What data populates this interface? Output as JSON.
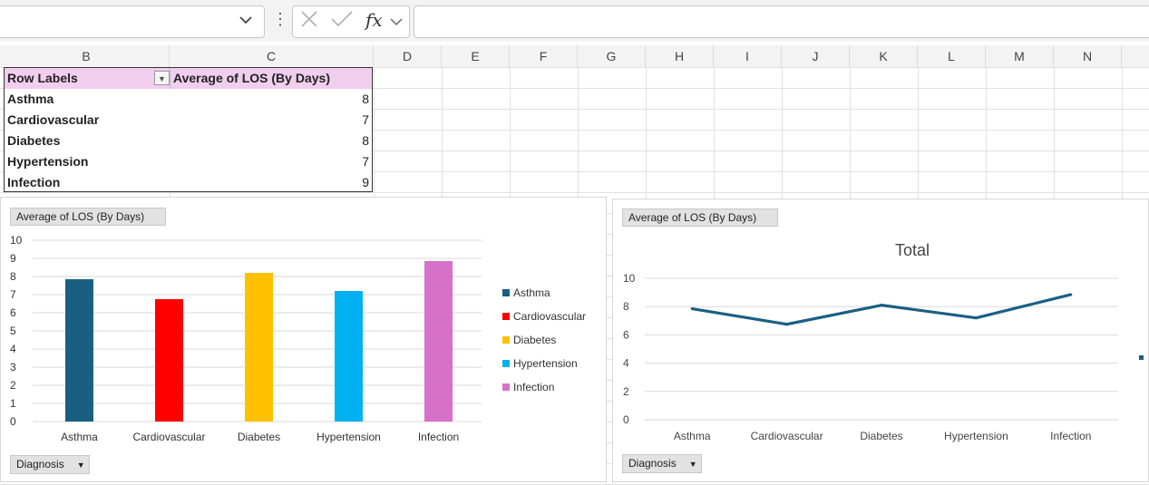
{
  "formula_bar": {
    "namebox_value": "",
    "fx_label": "fx",
    "formula_value": ""
  },
  "columns": [
    "B",
    "C",
    "D",
    "E",
    "F",
    "G",
    "H",
    "I",
    "J",
    "K",
    "L",
    "M",
    "N"
  ],
  "pivot": {
    "header_row_labels": "Row Labels",
    "header_value": "Average of LOS (By Days)",
    "rows": [
      {
        "label": "Asthma",
        "value": "8"
      },
      {
        "label": "Cardiovascular",
        "value": "7"
      },
      {
        "label": "Diabetes",
        "value": "8"
      },
      {
        "label": "Hypertension",
        "value": "7"
      },
      {
        "label": "Infection",
        "value": "9"
      }
    ]
  },
  "bar_chart": {
    "field_button": "Average of LOS (By Days)",
    "axis_button": "Diagnosis",
    "colors": [
      "#1a5f82",
      "#ff0000",
      "#ffc000",
      "#00b0f0",
      "#d670c9"
    ]
  },
  "line_chart": {
    "field_button": "Average of LOS (By Days)",
    "axis_button": "Diagnosis",
    "title": "Total",
    "line_color": "#1a5f82"
  },
  "chart_data": [
    {
      "type": "bar",
      "categories": [
        "Asthma",
        "Cardiovascular",
        "Diabetes",
        "Hypertension",
        "Infection"
      ],
      "values": [
        7.85,
        6.75,
        8.2,
        7.2,
        8.85
      ],
      "legend": [
        "Asthma",
        "Cardiovascular",
        "Diabetes",
        "Hypertension",
        "Infection"
      ],
      "ylim": [
        0,
        10
      ],
      "yticks": [
        "0",
        "1",
        "2",
        "3",
        "4",
        "5",
        "6",
        "7",
        "8",
        "9",
        "10"
      ],
      "grid": true,
      "legend_position": "right"
    },
    {
      "type": "line",
      "title": "Total",
      "categories": [
        "Asthma",
        "Cardiovascular",
        "Diabetes",
        "Hypertension",
        "Infection"
      ],
      "values": [
        7.85,
        6.75,
        8.1,
        7.2,
        8.85
      ],
      "ylim": [
        0,
        10
      ],
      "yticks": [
        "0",
        "2",
        "4",
        "6",
        "8",
        "10"
      ],
      "grid": true
    }
  ]
}
